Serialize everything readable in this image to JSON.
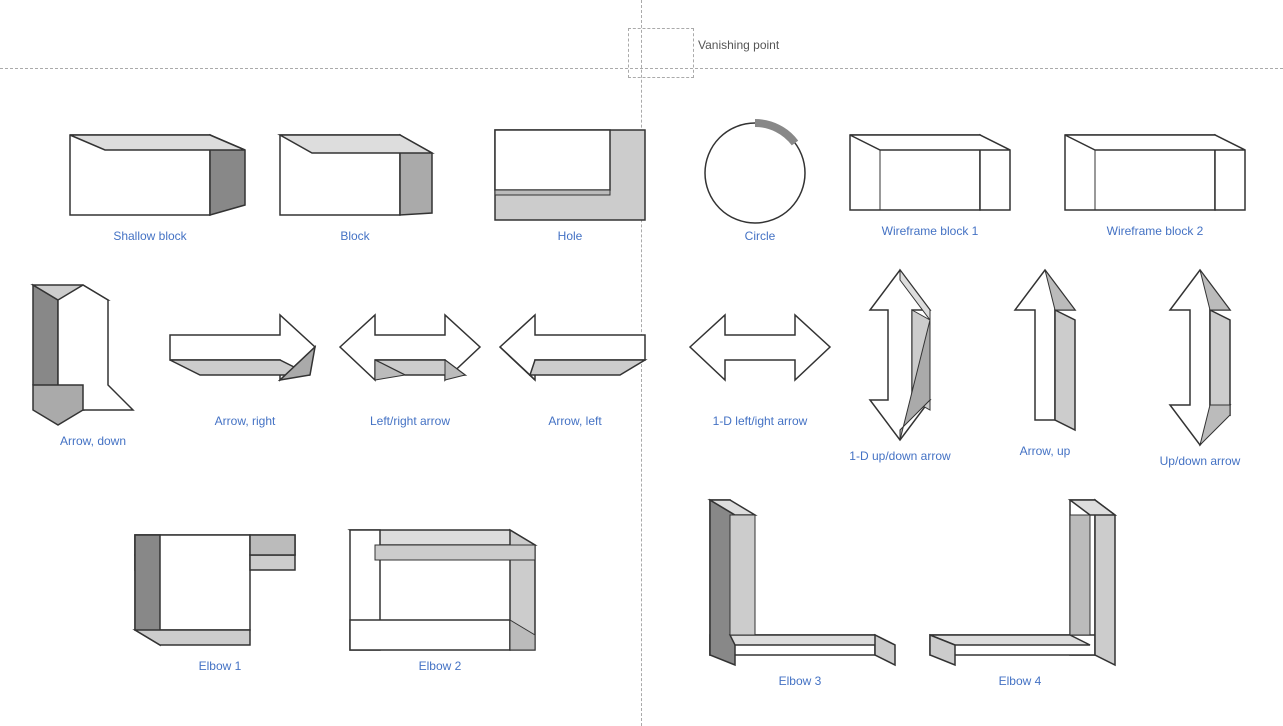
{
  "vanishing_point": {
    "label": "Vanishing point"
  },
  "shapes": [
    {
      "id": "shallow-block",
      "label": "Shallow block"
    },
    {
      "id": "block",
      "label": "Block"
    },
    {
      "id": "hole",
      "label": "Hole"
    },
    {
      "id": "circle",
      "label": "Circle"
    },
    {
      "id": "wireframe-block-1",
      "label": "Wireframe block 1"
    },
    {
      "id": "wireframe-block-2",
      "label": "Wireframe block 2"
    },
    {
      "id": "arrow-down",
      "label": "Arrow, down"
    },
    {
      "id": "arrow-right",
      "label": "Arrow, right"
    },
    {
      "id": "leftright-arrow",
      "label": "Left/right arrow"
    },
    {
      "id": "arrow-left",
      "label": "Arrow, left"
    },
    {
      "id": "1d-leftright-arrow",
      "label": "1-D left/ight arrow"
    },
    {
      "id": "1d-updown-arrow",
      "label": "1-D up/down arrow"
    },
    {
      "id": "arrow-up",
      "label": "Arrow, up"
    },
    {
      "id": "updown-arrow",
      "label": "Up/down arrow"
    },
    {
      "id": "elbow-1",
      "label": "Elbow 1"
    },
    {
      "id": "elbow-2",
      "label": "Elbow 2"
    },
    {
      "id": "elbow-3",
      "label": "Elbow 3"
    },
    {
      "id": "elbow-4",
      "label": "Elbow 4"
    }
  ]
}
